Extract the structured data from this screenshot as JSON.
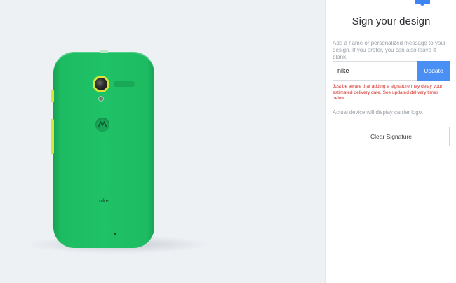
{
  "preview": {
    "signature_on_device": "nike",
    "colors": {
      "body": "#1fc266",
      "accent": "#d8e83b"
    }
  },
  "panel": {
    "title": "Sign your design",
    "description": "Add a name or personalized message to your design. If you prefer, you can also leave it blank.",
    "signature_input": {
      "value": "nike",
      "placeholder": ""
    },
    "update_label": "Update",
    "warning": "Just be aware that adding a signature may delay your estimated delivery date. See updated delivery times below.",
    "note": "Actual device will display carrier logo.",
    "clear_label": "Clear Signature",
    "colors": {
      "accent": "#4a8ff4",
      "warning": "#d6322b"
    }
  }
}
